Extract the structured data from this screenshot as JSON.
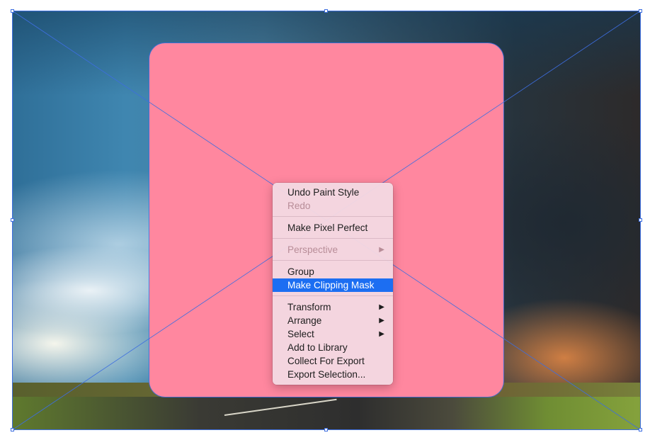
{
  "canvas": {
    "photo": "storm-landscape-image",
    "shape_fill": "#ff879f",
    "selection_color": "#3d6ee0"
  },
  "context_menu": {
    "highlight_color": "#1c6ef2",
    "groups": [
      [
        {
          "label": "Undo Paint Style",
          "enabled": true
        },
        {
          "label": "Redo",
          "enabled": false
        }
      ],
      [
        {
          "label": "Make Pixel Perfect",
          "enabled": true
        }
      ],
      [
        {
          "label": "Perspective",
          "enabled": false,
          "submenu": true
        }
      ],
      [
        {
          "label": "Group",
          "enabled": true
        },
        {
          "label": "Make Clipping Mask",
          "enabled": true,
          "highlighted": true
        }
      ],
      [
        {
          "label": "Transform",
          "enabled": true,
          "submenu": true
        },
        {
          "label": "Arrange",
          "enabled": true,
          "submenu": true
        },
        {
          "label": "Select",
          "enabled": true,
          "submenu": true
        },
        {
          "label": "Add to Library",
          "enabled": true
        },
        {
          "label": "Collect For Export",
          "enabled": true
        },
        {
          "label": "Export Selection...",
          "enabled": true
        }
      ]
    ],
    "submenu_arrow": "▶"
  }
}
